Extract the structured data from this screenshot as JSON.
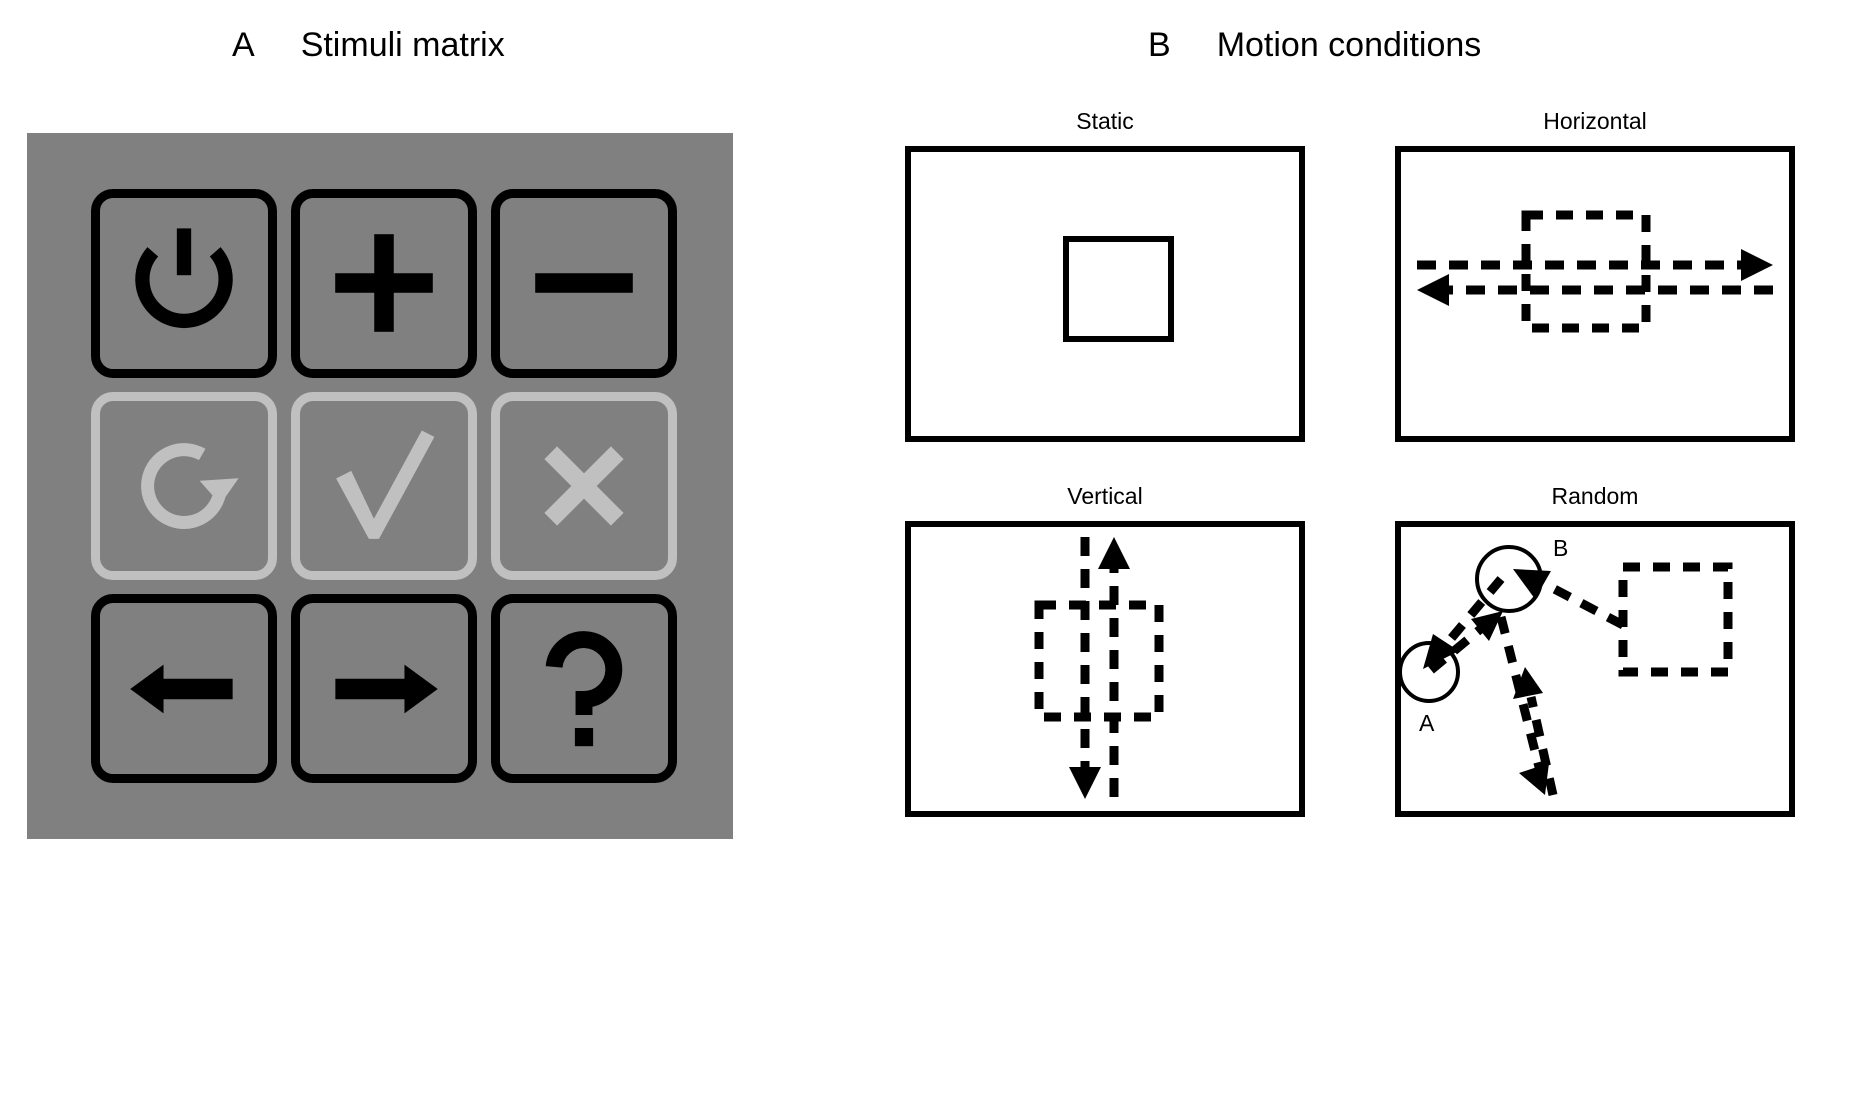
{
  "figure": {
    "background_color": "#ffffff",
    "panels": [
      {
        "letter": "A",
        "title": "Stimuli matrix"
      },
      {
        "letter": "B",
        "title": "Motion conditions"
      }
    ]
  },
  "panel_a": {
    "letter": "A",
    "title": "Stimuli matrix",
    "background_color": "#808080",
    "dark_color": "#000000",
    "light_color": "#c0c0c0",
    "cells": [
      {
        "icon": "power-icon",
        "label": "Power",
        "row": 1,
        "col": 1,
        "style": "dark"
      },
      {
        "icon": "plus-icon",
        "label": "Plus",
        "row": 1,
        "col": 2,
        "style": "dark"
      },
      {
        "icon": "minus-icon",
        "label": "Minus",
        "row": 1,
        "col": 3,
        "style": "dark"
      },
      {
        "icon": "refresh-icon",
        "label": "Refresh",
        "row": 2,
        "col": 1,
        "style": "light"
      },
      {
        "icon": "checkmark-icon",
        "label": "Checkmark",
        "row": 2,
        "col": 2,
        "style": "light"
      },
      {
        "icon": "cross-icon",
        "label": "Cross",
        "row": 2,
        "col": 3,
        "style": "light"
      },
      {
        "icon": "arrow-left-icon",
        "label": "Arrow left",
        "row": 3,
        "col": 1,
        "style": "dark"
      },
      {
        "icon": "arrow-right-icon",
        "label": "Arrow right",
        "row": 3,
        "col": 2,
        "style": "dark"
      },
      {
        "icon": "question-mark-icon",
        "label": "Question",
        "row": 3,
        "col": 3,
        "style": "dark"
      }
    ]
  },
  "panel_b": {
    "letter": "B",
    "title": "Motion conditions",
    "conditions": [
      {
        "name": "static",
        "label": "Static",
        "annotations": []
      },
      {
        "name": "horizontal",
        "label": "Horizontal",
        "annotations": []
      },
      {
        "name": "vertical",
        "label": "Vertical",
        "annotations": []
      },
      {
        "name": "random",
        "label": "Random",
        "annotations": [
          "A",
          "B"
        ]
      }
    ],
    "random_markers": {
      "a": "A",
      "b": "B"
    }
  }
}
